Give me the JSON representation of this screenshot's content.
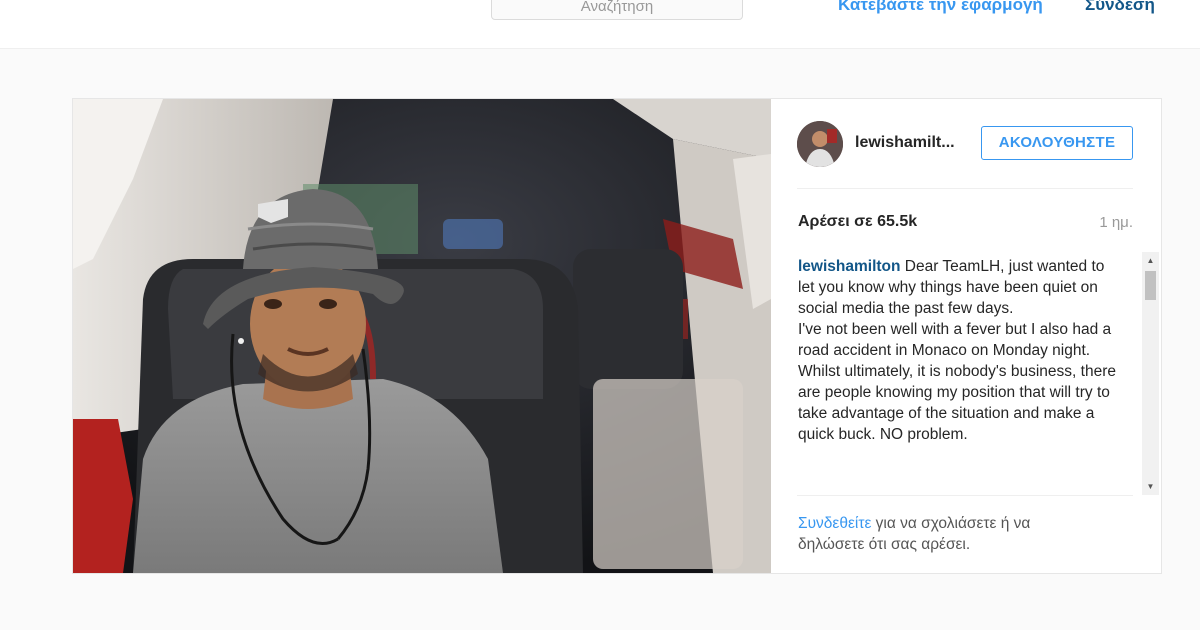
{
  "header": {
    "search_placeholder": "Αναζήτηση",
    "download_app": "Κατεβάστε την εφαρμογή",
    "login": "Σύνδεση"
  },
  "post": {
    "username_short": "lewishamilt...",
    "follow_label": "ΑΚΟΛΟΥΘΗΣΤΕ",
    "likes": "Αρέσει σε 65.5k",
    "time_ago": "1 ημ.",
    "caption": {
      "author": "lewishamilton",
      "lines": [
        " Dear TeamLH, just wanted to let you know why things have been quiet on social media the past few days.",
        "I've not been well with a fever but I also had a road accident in Monaco on Monday night.",
        "Whilst ultimately, it is nobody's business, there are people knowing my position that will try to take advantage of the situation and make a quick buck. NO problem."
      ]
    },
    "login_prompt": {
      "link": "Συνδεθείτε",
      "rest": " για να σχολιάσετε ή να δηλώσετε ότι σας αρέσει."
    }
  },
  "icons": {
    "scroll_up": "▲",
    "scroll_down": "▼"
  }
}
